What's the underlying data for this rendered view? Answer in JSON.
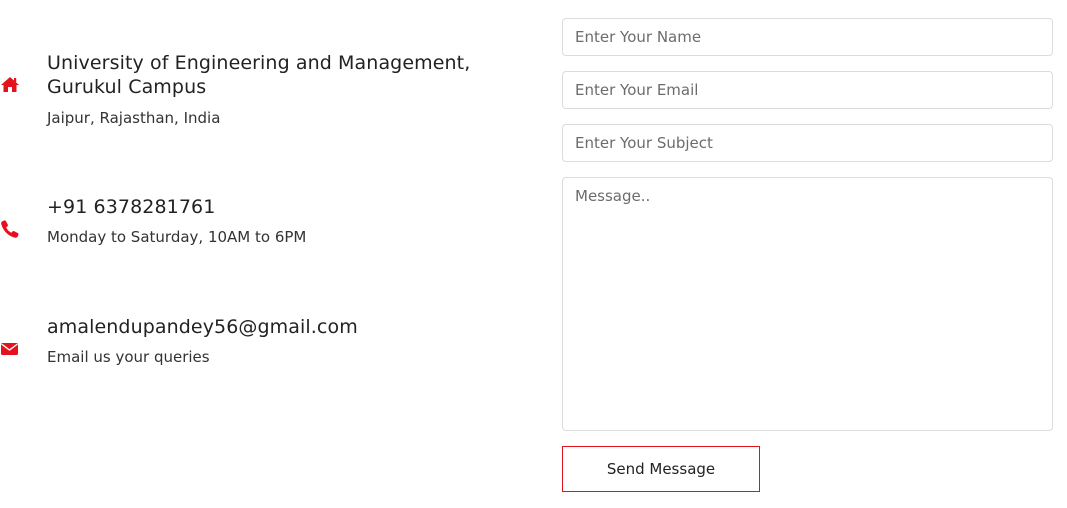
{
  "contact_info": {
    "accent_color": "#e3121d",
    "address": {
      "icon": "home-icon",
      "title_line1": "University of Engineering and Management,",
      "title_line2": "Gurukul Campus",
      "subtitle": "Jaipur, Rajasthan, India"
    },
    "phone": {
      "icon": "phone-icon",
      "title": "+91 6378281761",
      "subtitle": "Monday to Saturday, 10AM to 6PM"
    },
    "email": {
      "icon": "envelope-icon",
      "title": "amalendupandey56@gmail.com",
      "subtitle": "Email us your queries"
    }
  },
  "form": {
    "name_placeholder": "Enter Your Name",
    "email_placeholder": "Enter Your Email",
    "subject_placeholder": "Enter Your Subject",
    "message_placeholder": "Message..",
    "submit_label": "Send Message"
  }
}
